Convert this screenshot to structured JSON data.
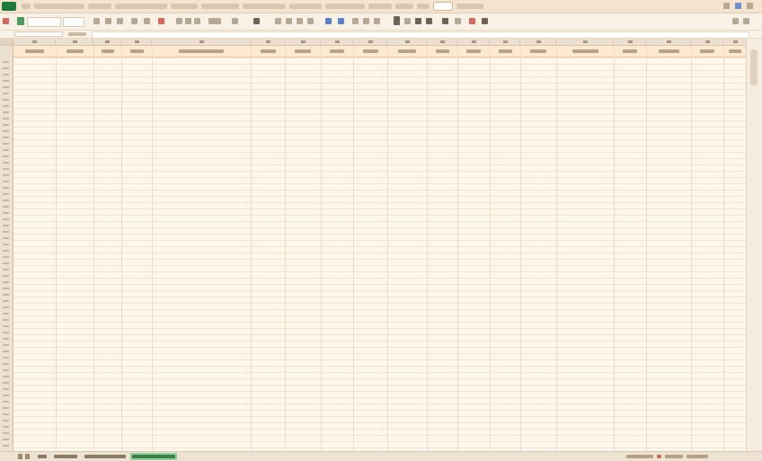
{
  "menu": {
    "tabs": [
      {
        "label": ""
      },
      {
        "label": ""
      },
      {
        "label": ""
      },
      {
        "label": ""
      },
      {
        "label": ""
      },
      {
        "label": ""
      },
      {
        "label": ""
      },
      {
        "label": ""
      },
      {
        "label": ""
      },
      {
        "label": ""
      },
      {
        "label": ""
      },
      {
        "label": ""
      },
      {
        "label": ""
      },
      {
        "label": ""
      }
    ],
    "active_tab_index": 12
  },
  "toolbar": {
    "font_name": "",
    "font_size": ""
  },
  "formula_bar": {
    "name_box": "",
    "formula": ""
  },
  "sheet": {
    "header_cells": [
      {
        "label": ""
      },
      {
        "label": ""
      },
      {
        "label": ""
      },
      {
        "label": ""
      },
      {
        "label": ""
      },
      {
        "label": ""
      },
      {
        "label": ""
      },
      {
        "label": ""
      },
      {
        "label": ""
      },
      {
        "label": ""
      },
      {
        "label": ""
      },
      {
        "label": ""
      },
      {
        "label": ""
      },
      {
        "label": ""
      },
      {
        "label": ""
      },
      {
        "label": ""
      },
      {
        "label": ""
      },
      {
        "label": ""
      },
      {
        "label": ""
      }
    ],
    "body_rows_empty": true
  },
  "sheet_tabs": [
    {
      "label": ""
    },
    {
      "label": ""
    },
    {
      "label": ""
    },
    {
      "label": ""
    }
  ],
  "active_sheet_index": 3,
  "colors": {
    "accent": "#1f7a3a",
    "header_fill": "#fde8d2",
    "sheet_fill": "#fff7ec",
    "active_tab": "#8fcf9a"
  }
}
